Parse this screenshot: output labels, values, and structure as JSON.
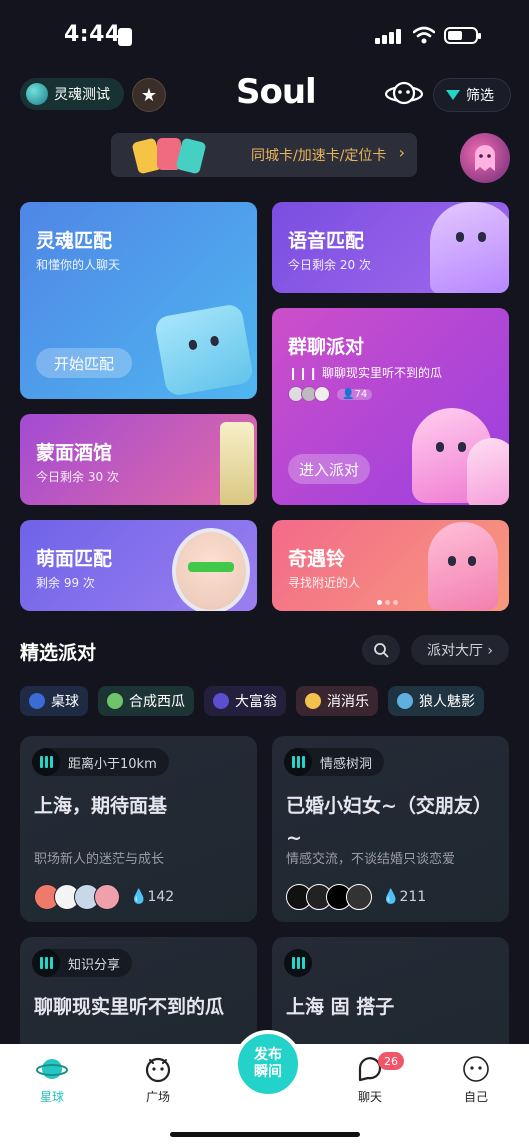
{
  "status_bar": {
    "time": "4:44"
  },
  "header": {
    "soul_test_label": "灵魂测试",
    "logo": "Soul",
    "filter_label": "筛选"
  },
  "banner": {
    "text": "同城卡/加速卡/定位卡",
    "chevron": "›"
  },
  "cards": {
    "soul_match": {
      "title": "灵魂匹配",
      "subtitle": "和懂你的人聊天",
      "button": "开始匹配"
    },
    "voice_match": {
      "title": "语音匹配",
      "subtitle": "今日剩余 20 次"
    },
    "group_party": {
      "title": "群聊派对",
      "subtitle": "聊聊现实里听不到的瓜",
      "count": "74",
      "button": "进入派对"
    },
    "masked_bar": {
      "title": "蒙面酒馆",
      "subtitle": "今日剩余 30 次"
    },
    "cute_match": {
      "title": "萌面匹配",
      "subtitle": "剩余 99 次"
    },
    "encounter_bell": {
      "title": "奇遇铃",
      "subtitle": "寻找附近的人"
    }
  },
  "section": {
    "title": "精选派对",
    "hall_button": "派对大厅 ›"
  },
  "chips": [
    {
      "label": "桌球",
      "bg": "#1f2a44",
      "icon_color": "#3b6bd6"
    },
    {
      "label": "合成西瓜",
      "bg": "#1d3435",
      "icon_color": "#6fc46a"
    },
    {
      "label": "大富翁",
      "bg": "#231f3c",
      "icon_color": "#5b4fd0"
    },
    {
      "label": "消消乐",
      "bg": "#3a2630",
      "icon_color": "#f2c14e"
    },
    {
      "label": "狼人魅影",
      "bg": "#1f3340",
      "icon_color": "#5fb0e0"
    }
  ],
  "parties": [
    {
      "tag": "距离小于10km",
      "title": "上海，期待面基",
      "desc": "职场新人的迷茫与成长",
      "count": "142"
    },
    {
      "tag": "情感树洞",
      "title": "已婚小妇女~（交朋友）~",
      "desc": "情感交流，不谈结婚只谈恋爱",
      "count": "211"
    },
    {
      "tag": "知识分享",
      "title": "聊聊现实里听不到的瓜"
    },
    {
      "tag": "",
      "title": "上海 固 搭子"
    }
  ],
  "bottom_nav": {
    "planet": "星球",
    "square": "广场",
    "publish": "发布\n瞬间",
    "chat": "聊天",
    "chat_badge": "26",
    "me": "自己"
  },
  "colors": {
    "accent": "#23d6c8",
    "banner_text": "#e8b35a",
    "badge": "#f0556a",
    "background": "#14141e"
  }
}
